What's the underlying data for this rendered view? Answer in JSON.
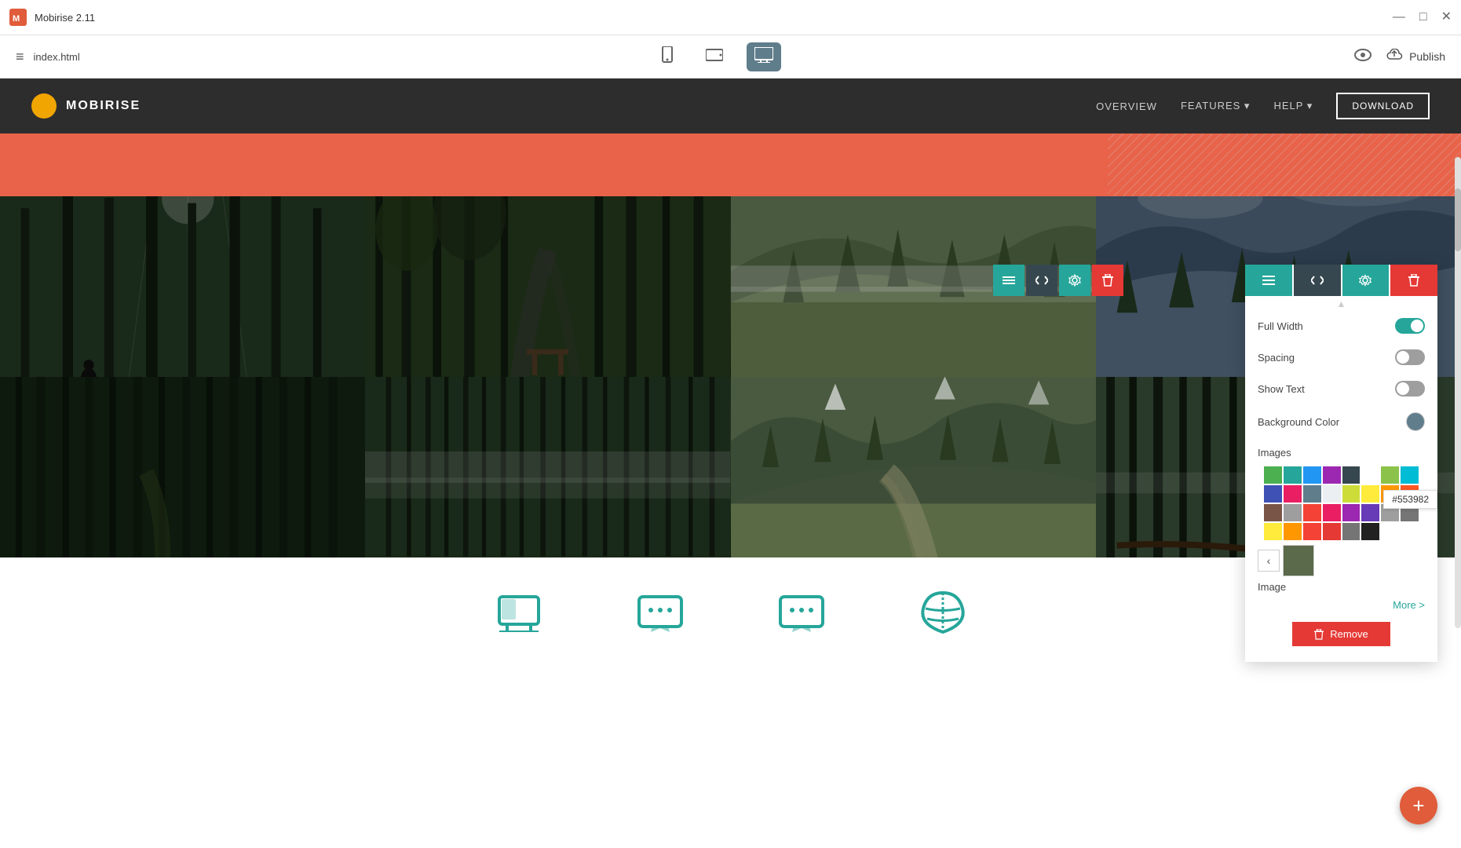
{
  "app": {
    "title": "Mobirise 2.11",
    "filename": "index.html"
  },
  "titlebar": {
    "title": "Mobirise 2.11",
    "minimize_label": "—",
    "maximize_label": "□",
    "close_label": "✕"
  },
  "toolbar": {
    "menu_icon": "≡",
    "filename": "index.html",
    "devices": [
      {
        "id": "mobile",
        "icon": "📱",
        "label": "Mobile",
        "active": false
      },
      {
        "id": "tablet",
        "icon": "⬜",
        "label": "Tablet",
        "active": false
      },
      {
        "id": "desktop",
        "icon": "🖥",
        "label": "Desktop",
        "active": true
      }
    ],
    "publish_label": "Publish"
  },
  "navbar": {
    "brand": "MOBIRISE",
    "links": [
      "OVERVIEW",
      "FEATURES ▾",
      "HELP ▾"
    ],
    "download_label": "DOWNLOAD"
  },
  "block_controls": {
    "sort_icon": "⇅",
    "code_icon": "</>",
    "gear_icon": "⚙",
    "delete_icon": "🗑"
  },
  "settings_panel": {
    "header_buttons": [
      {
        "id": "sort",
        "icon": "⇅",
        "bg": "teal"
      },
      {
        "id": "code",
        "icon": "</>",
        "bg": "dark"
      },
      {
        "id": "gear",
        "icon": "⚙",
        "bg": "teal"
      },
      {
        "id": "delete",
        "icon": "🗑",
        "bg": "red"
      }
    ],
    "full_width_label": "Full Width",
    "full_width_value": true,
    "spacing_label": "Spacing",
    "spacing_value": false,
    "show_text_label": "Show Text",
    "show_text_value": false,
    "bg_color_label": "Background Color",
    "images_label": "Images",
    "image_label": "Image",
    "more_label": "More >",
    "remove_label": "Remove",
    "color_hex": "#553982",
    "palette_colors": [
      "#4caf50",
      "#26a69a",
      "#2196f3",
      "#9c27b0",
      "#37474f",
      "#8bc34a",
      "#00bcd4",
      "#3f51b5",
      "#e91e63",
      "#607d8b",
      "#cddc39",
      "#ffeb3b",
      "#ff9800",
      "#ff5722",
      "#795548",
      "#f44336",
      "#e91e63",
      "#9e9e9e",
      "#37474f",
      "#212121",
      "#ffeb3b",
      "#ff9800",
      "#f44336",
      "#e53935",
      "#9e9e9e",
      "#bdbdbd",
      "#757575",
      "#424242",
      "#212121",
      "#000000"
    ]
  },
  "gallery": {
    "cells": [
      {
        "id": 1,
        "type": "forest-1"
      },
      {
        "id": 2,
        "type": "forest-2"
      },
      {
        "id": 3,
        "type": "forest-3"
      },
      {
        "id": 4,
        "type": "forest-4"
      },
      {
        "id": 5,
        "type": "forest-5"
      },
      {
        "id": 6,
        "type": "forest-6"
      },
      {
        "id": 7,
        "type": "forest-7"
      },
      {
        "id": 8,
        "type": "forest-8"
      }
    ]
  },
  "fab": {
    "icon": "+"
  },
  "feature_icons": [
    "🖵",
    "💬",
    "💬",
    "◐"
  ]
}
